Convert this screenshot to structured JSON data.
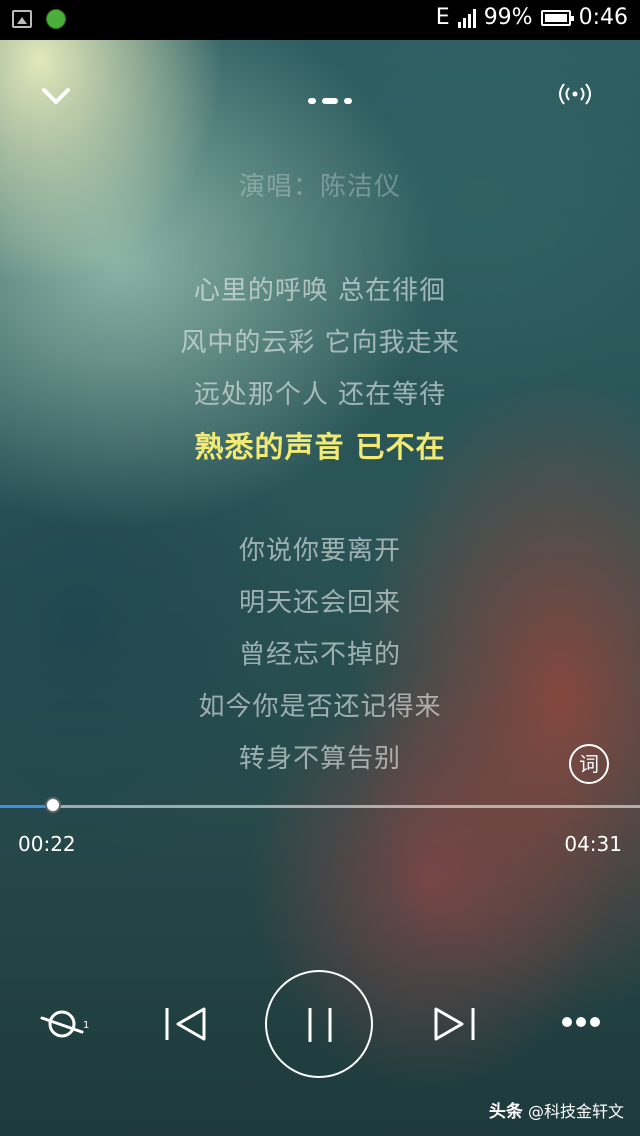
{
  "status_bar": {
    "network": "E",
    "battery_percent": "99%",
    "time": "0:46"
  },
  "lyrics": {
    "artist_line": "演唱：陈洁仪",
    "lines": [
      "心里的呼唤 总在徘徊",
      "风中的云彩 它向我走来",
      "远处那个人 还在等待",
      "熟悉的声音 已不在",
      "你说你要离开",
      "明天还会回来",
      "曾经忘不掉的",
      "如今你是否还记得来",
      "转身不算告别"
    ],
    "active_index": 3,
    "lyrics_toggle_label": "词"
  },
  "playback": {
    "elapsed": "00:22",
    "total": "04:31",
    "progress_fraction": 0.081,
    "accent_color": "#3b8fe0",
    "highlight_color": "#f2ea72"
  },
  "icons": {
    "collapse": "chevron-down-icon",
    "page_indicator": "page-dots-icon",
    "cast": "broadcast-icon",
    "play_mode": "loop-once-icon",
    "previous": "previous-track-icon",
    "pause": "pause-icon",
    "next": "next-track-icon",
    "more": "more-icon"
  },
  "watermark": {
    "brand": "头条",
    "handle": "@科技金轩文"
  }
}
